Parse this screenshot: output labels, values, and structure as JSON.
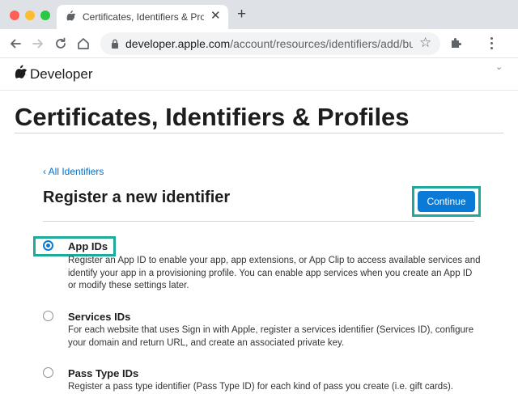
{
  "browser": {
    "tab_title": "Certificates, Identifiers & Profiles",
    "tab_close": "✕",
    "new_tab": "+",
    "url_host": "developer.apple.com",
    "url_path": "/account/resources/identifiers/add/bu...",
    "star": "☆"
  },
  "header": {
    "brand": "Developer",
    "chevron": "⌄"
  },
  "page": {
    "title": "Certificates, Identifiers & Profiles"
  },
  "section": {
    "back_link": "‹ All Identifiers",
    "title": "Register a new identifier",
    "continue_label": "Continue"
  },
  "options": [
    {
      "title": "App IDs",
      "description": "Register an App ID to enable your app, app extensions, or App Clip to access available services and identify your app in a provisioning profile. You can enable app services when you create an App ID or modify these settings later.",
      "selected": true
    },
    {
      "title": "Services IDs",
      "description": "For each website that uses Sign in with Apple, register a services identifier (Services ID), configure your domain and return URL, and create an associated private key.",
      "selected": false
    },
    {
      "title": "Pass Type IDs",
      "description": "Register a pass type identifier (Pass Type ID) for each kind of pass you create (i.e. gift cards).",
      "selected": false
    }
  ],
  "colors": {
    "accent": "#0a7ad6",
    "link": "#0070c9",
    "highlight": "#1fa99a"
  }
}
